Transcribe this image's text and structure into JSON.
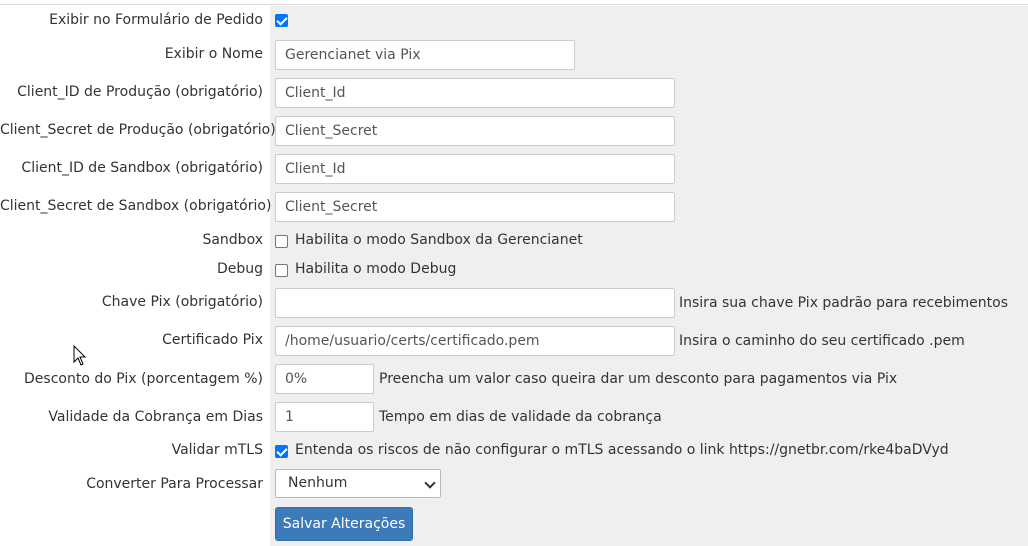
{
  "form": {
    "show_in_form": {
      "label": "Exibir no Formulário de Pedido",
      "checked": true
    },
    "display_name": {
      "label": "Exibir o Nome",
      "value": "Gerencianet via Pix"
    },
    "client_id_prod": {
      "label": "Client_ID de Produção (obrigatório)",
      "value": "Client_Id"
    },
    "client_secret_prod": {
      "label": "Client_Secret de Produção (obrigatório)",
      "value": "Client_Secret"
    },
    "client_id_sandbox": {
      "label": "Client_ID de Sandbox (obrigatório)",
      "value": "Client_Id"
    },
    "client_secret_sandbox": {
      "label": "Client_Secret de Sandbox (obrigatório)",
      "value": "Client_Secret"
    },
    "sandbox": {
      "label": "Sandbox",
      "checkbox_text": "Habilita o modo Sandbox da Gerencianet",
      "checked": false
    },
    "debug": {
      "label": "Debug",
      "checkbox_text": "Habilita o modo Debug",
      "checked": false
    },
    "pix_key": {
      "label": "Chave Pix (obrigatório)",
      "value": "",
      "hint": "Insira sua chave Pix padrão para recebimentos"
    },
    "pix_cert": {
      "label": "Certificado Pix",
      "value": "/home/usuario/certs/certificado.pem",
      "hint": "Insira o caminho do seu certificado .pem"
    },
    "discount": {
      "label": "Desconto do Pix (porcentagem %)",
      "value": "0%",
      "hint": "Preencha um valor caso queira dar um desconto para pagamentos via Pix"
    },
    "due_days": {
      "label": "Validade da Cobrança em Dias",
      "value": "1",
      "hint": "Tempo em dias de validade da cobrança"
    },
    "mtls": {
      "label": "Validar mTLS",
      "checkbox_text": "Entenda os riscos de não configurar o mTLS acessando o link https://gnetbr.com/rke4baDVyd",
      "checked": true
    },
    "convert": {
      "label": "Converter Para Processar",
      "selected": "Nenhum"
    },
    "save_label": "Salvar Alterações"
  },
  "icons": {
    "cursor": "mouse-pointer-icon",
    "chevron": "chevron-down-icon"
  },
  "colors": {
    "accent": "#3d7ab9",
    "checkbox_checked": "#0075ff",
    "panel_bg": "#efefef"
  }
}
